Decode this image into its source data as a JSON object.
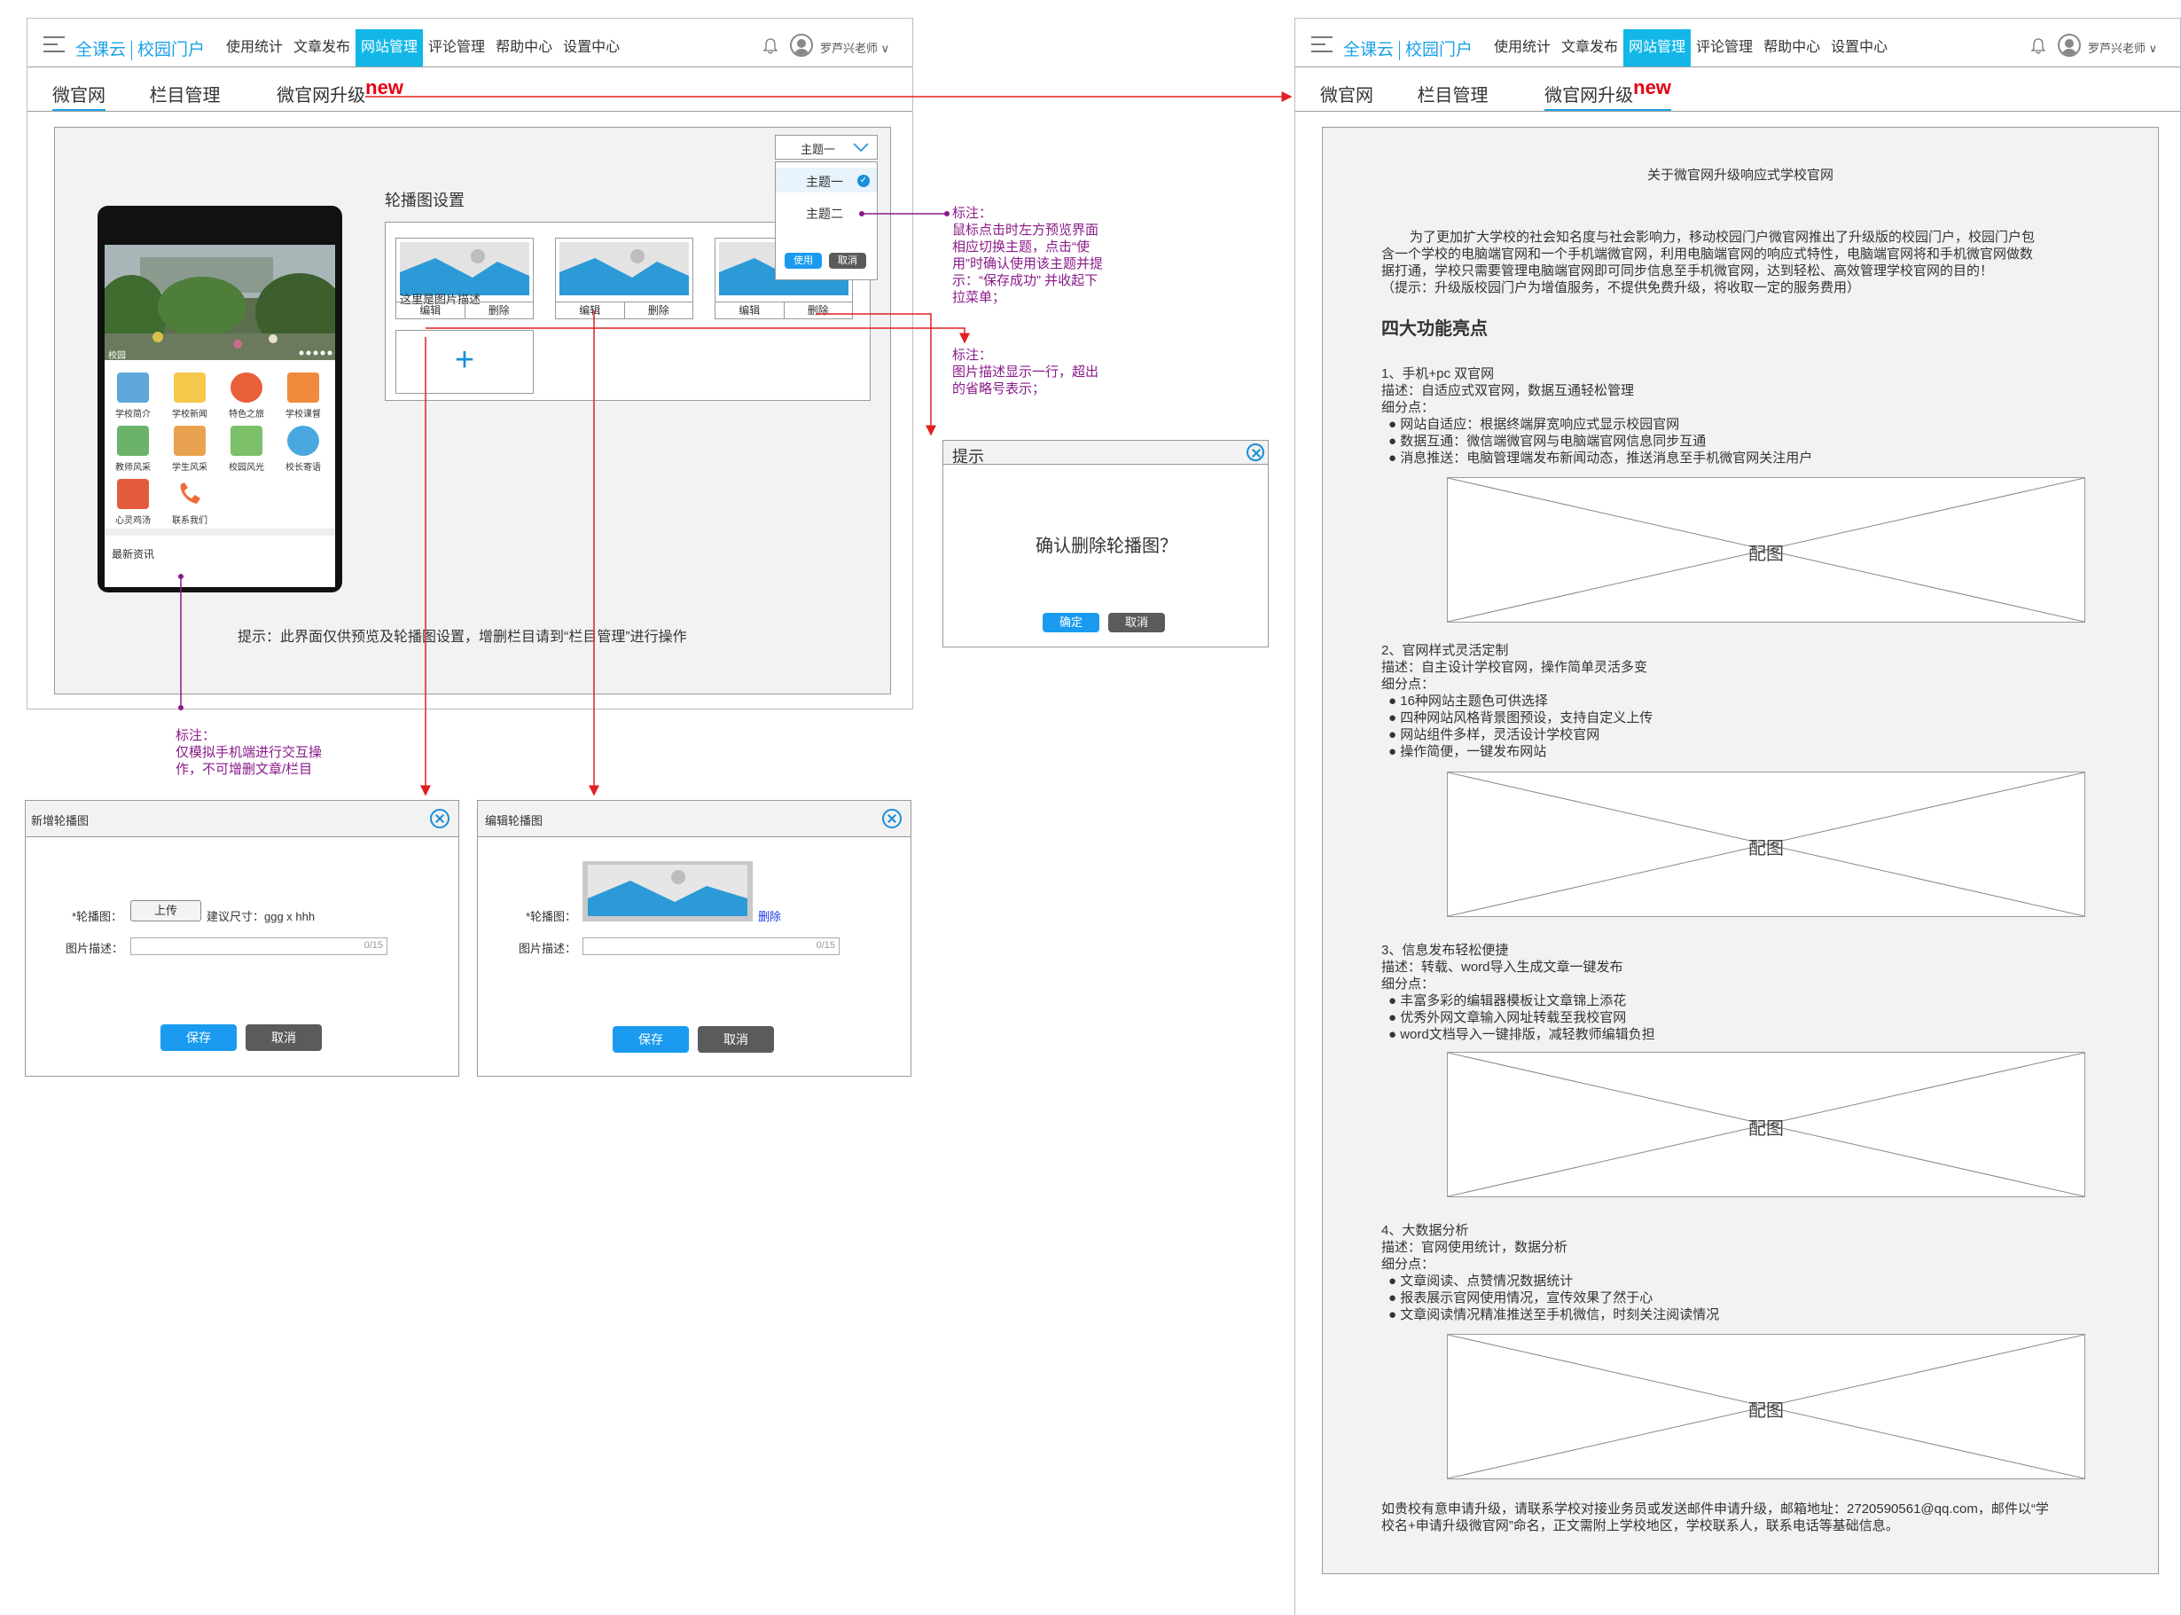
{
  "header": {
    "brand_a": "全课云",
    "brand_b": "校园门户",
    "nav": [
      "使用统计",
      "文章发布",
      "网站管理",
      "评论管理",
      "帮助中心",
      "设置中心"
    ],
    "active_nav": "网站管理",
    "user": "罗芦兴老师"
  },
  "subtabs": [
    "微官网",
    "栏目管理",
    "微官网升级"
  ],
  "new_tag": "new",
  "preview": {
    "carousel_title": "轮播图设置",
    "theme_select": "主题一",
    "theme_options": [
      "主题一",
      "主题二"
    ],
    "use_btn": "使用",
    "cancel_btn": "取消",
    "card_desc": "这里是图片描述",
    "edit": "编辑",
    "delete": "删除",
    "add": "+",
    "hint": "提示：此界面仅供预览及轮播图设置，增删栏目请到“栏目管理”进行操作",
    "phone_caption": "校园",
    "phone_news": "最新资讯",
    "phone_grid": [
      "学校简介",
      "学校新闻",
      "特色之旅",
      "学校课督",
      "教师风采",
      "学生风采",
      "校园风光",
      "校长寄语",
      "心灵鸡汤",
      "联系我们"
    ]
  },
  "annotations": {
    "theme": [
      "标注：",
      "鼠标点击时左方预览界面",
      "相应切换主题，点击“使",
      "用”时确认使用该主题并提",
      "示：“保存成功” 并收起下",
      "拉菜单；"
    ],
    "desc": [
      "标注：",
      "图片描述显示一行，超出",
      "的省略号表示；"
    ],
    "phone": [
      "标注：",
      "仅模拟手机端进行交互操",
      "作，不可增删文章/栏目"
    ]
  },
  "confirm_dialog": {
    "title": "提示",
    "message": "确认删除轮播图？",
    "ok": "确定",
    "cancel": "取消"
  },
  "add_dialog": {
    "title": "新增轮播图",
    "image_label": "*轮播图：",
    "upload": "上传",
    "size_hint": "建议尺寸：ggg x hhh",
    "desc_label": "图片描述：",
    "counter": "0/15",
    "save": "保存",
    "cancel": "取消"
  },
  "edit_dialog": {
    "title": "编辑轮播图",
    "image_label": "*轮播图：",
    "delete": "删除",
    "desc_label": "图片描述：",
    "counter": "0/15",
    "save": "保存",
    "cancel": "取消"
  },
  "doc": {
    "title": "关于微官网升级响应式学校官网",
    "intro": [
      "为了更加扩大学校的社会知名度与社会影响力，移动校园门户微官网推出了升级版的校园门户，校园门户包",
      "含一个学校的电脑端官网和一个手机端微官网，利用电脑端官网的响应式特性，电脑端官网将和手机微官网做数",
      "据打通，学校只需要管理电脑端官网即可同步信息至手机微官网，达到轻松、高效管理学校官网的目的！",
      "（提示：升级版校园门户为增值服务，不提供免费升级，将收取一定的服务费用）"
    ],
    "features_title": "四大功能亮点",
    "f1": [
      "1、手机+pc 双官网",
      "描述：自适应式双官网，数据互通轻松管理",
      "细分点：",
      "● 网站自适应：根据终端屏宽响应式显示校园官网",
      "● 数据互通：微信端微官网与电脑端官网信息同步互通",
      "● 消息推送：电脑管理端发布新闻动态，推送消息至手机微官网关注用户"
    ],
    "f2": [
      "2、官网样式灵活定制",
      "描述：自主设计学校官网，操作简单灵活多变",
      "细分点：",
      "● 16种网站主题色可供选择",
      "● 四种网站风格背景图预设，支持自定义上传",
      "● 网站组件多样，灵活设计学校官网",
      "● 操作简便，一键发布网站"
    ],
    "f3": [
      "3、信息发布轻松便捷",
      "描述：转载、word导入生成文章一键发布",
      "细分点：",
      "● 丰富多彩的编辑器模板让文章锦上添花",
      "● 优秀外网文章输入网址转载至我校官网",
      "● word文档导入一键排版，减轻教师编辑负担"
    ],
    "f4": [
      "4、大数据分析",
      "描述：官网使用统计，数据分析",
      "细分点：",
      "● 文章阅读、点赞情况数据统计",
      "● 报表展示官网使用情况，宣传效果了然于心",
      "● 文章阅读情况精准推送至手机微信，时刻关注阅读情况"
    ],
    "image_placeholder": "配图",
    "footer": [
      "如贵校有意申请升级，请联系学校对接业务员或发送邮件申请升级，邮箱地址：2720590561@qq.com，邮件以“学",
      "校名+申请升级微官网”命名，正文需附上学校地区，学校联系人，联系电话等基础信息。"
    ]
  },
  "colors": {
    "accent": "#1aa2e8",
    "nav_active": "#12b7e8",
    "new_red": "#e60012",
    "annotation": "#8a1a8a",
    "btn_blue": "#1a9bf0",
    "btn_dark": "#5b5b5b"
  }
}
